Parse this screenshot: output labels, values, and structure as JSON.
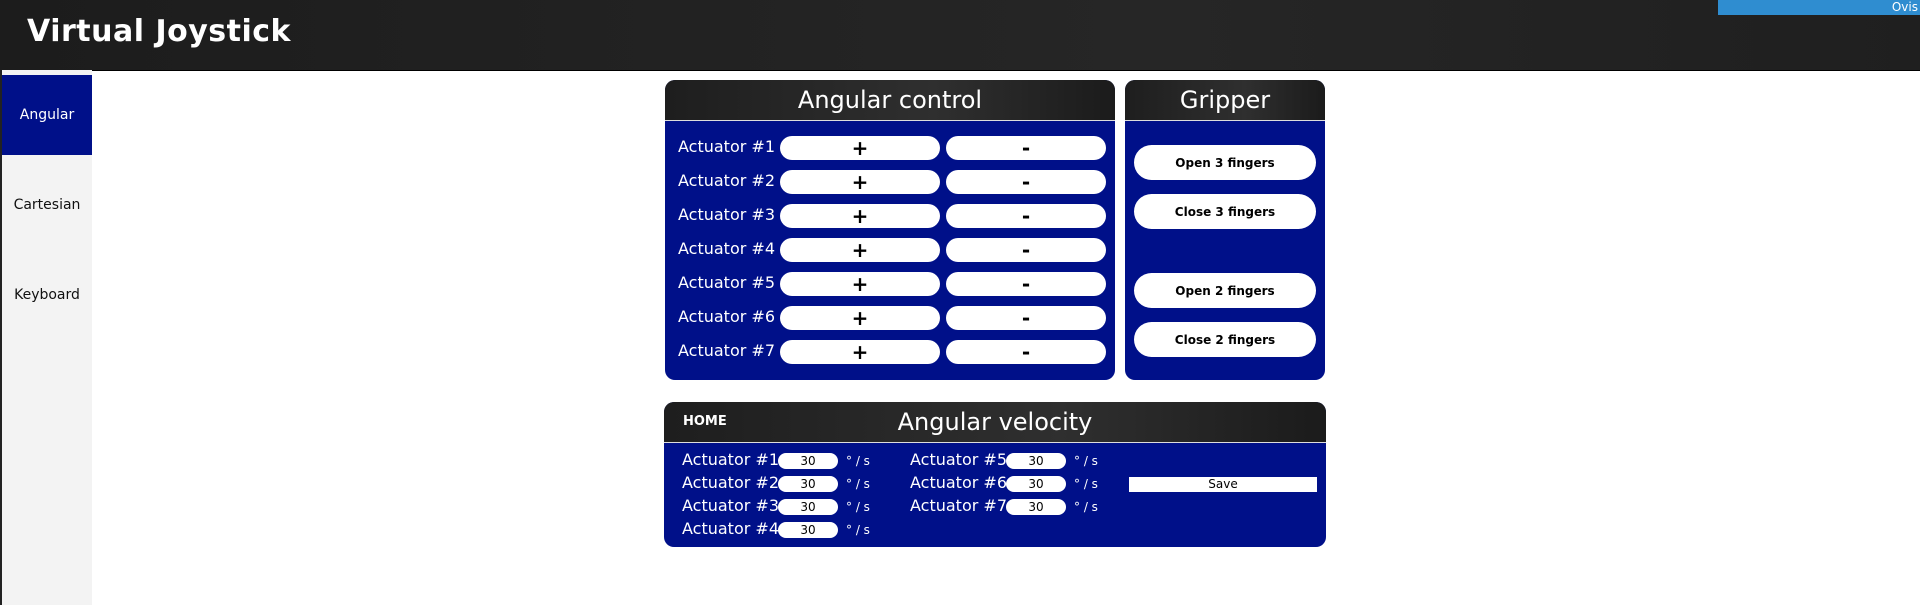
{
  "header": {
    "title": "Virtual Joystick",
    "user": "Ovis"
  },
  "sidebar": {
    "items": [
      {
        "label": "Angular",
        "active": true
      },
      {
        "label": "Cartesian",
        "active": false
      },
      {
        "label": "Keyboard",
        "active": false
      }
    ]
  },
  "angular_control": {
    "title": "Angular control",
    "plus_label": "+",
    "minus_label": "-",
    "actuators": [
      "Actuator #1",
      "Actuator #2",
      "Actuator #3",
      "Actuator #4",
      "Actuator #5",
      "Actuator #6",
      "Actuator #7"
    ]
  },
  "gripper": {
    "title": "Gripper",
    "buttons": [
      "Open 3 fingers",
      "Close 3 fingers",
      "Open 2 fingers",
      "Close 2 fingers"
    ]
  },
  "angular_velocity": {
    "title": "Angular velocity",
    "home_label": "HOME",
    "unit": "° / s",
    "save_label": "Save",
    "actuators": [
      {
        "label": "Actuator #1",
        "value": "30"
      },
      {
        "label": "Actuator #2",
        "value": "30"
      },
      {
        "label": "Actuator #3",
        "value": "30"
      },
      {
        "label": "Actuator #4",
        "value": "30"
      },
      {
        "label": "Actuator #5",
        "value": "30"
      },
      {
        "label": "Actuator #6",
        "value": "30"
      },
      {
        "label": "Actuator #7",
        "value": "30"
      }
    ]
  },
  "colors": {
    "panel": "#001089",
    "header_bar": "#1c1c1c",
    "user_badge": "#2f8dd0",
    "sidebar": "#f3f3f3"
  }
}
